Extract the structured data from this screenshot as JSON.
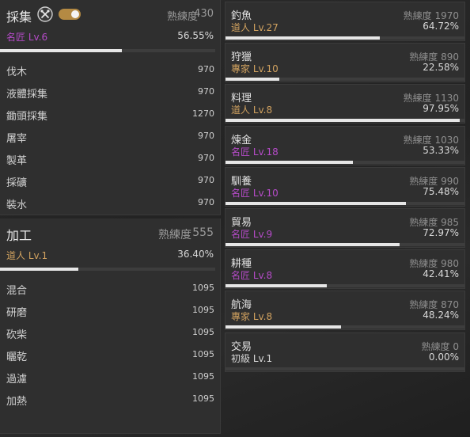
{
  "colors": {
    "level_purple": "#b64bc9",
    "level_gold": "#d0a15f",
    "bar_fill": "#e6e6e6",
    "toggle_accent": "#b48a43"
  },
  "gathering": {
    "title": "採集",
    "icon": "crossed-tools-icon",
    "toggle_state": "on",
    "prof_label": "熟練度",
    "prof_value": "430",
    "level": "名匠 Lv.6",
    "percent": "56.55%",
    "progress": 0.5655,
    "subs": [
      {
        "name": "伐木",
        "value": "970"
      },
      {
        "name": "液體採集",
        "value": "970"
      },
      {
        "name": "鋤頭採集",
        "value": "1270"
      },
      {
        "name": "屠宰",
        "value": "970"
      },
      {
        "name": "製革",
        "value": "970"
      },
      {
        "name": "採礦",
        "value": "970"
      },
      {
        "name": "裝水",
        "value": "970"
      }
    ]
  },
  "processing": {
    "title": "加工",
    "prof_label": "熟練度",
    "prof_value": "555",
    "level": "道人 Lv.1",
    "percent": "36.40%",
    "progress": 0.364,
    "subs": [
      {
        "name": "混合",
        "value": "1095"
      },
      {
        "name": "研磨",
        "value": "1095"
      },
      {
        "name": "砍柴",
        "value": "1095"
      },
      {
        "name": "曬乾",
        "value": "1095"
      },
      {
        "name": "過濾",
        "value": "1095"
      },
      {
        "name": "加熱",
        "value": "1095"
      }
    ]
  },
  "skills": [
    {
      "name": "釣魚",
      "prof_label": "熟練度",
      "prof_value": "1970",
      "level": "道人 Lv.27",
      "level_color": "gold",
      "percent": "64.72%",
      "progress": 0.6472
    },
    {
      "name": "狩獵",
      "prof_label": "熟練度",
      "prof_value": "890",
      "level": "專家 Lv.10",
      "level_color": "gold",
      "percent": "22.58%",
      "progress": 0.2258
    },
    {
      "name": "料理",
      "prof_label": "熟練度",
      "prof_value": "1130",
      "level": "道人 Lv.8",
      "level_color": "gold",
      "percent": "97.95%",
      "progress": 0.9795
    },
    {
      "name": "煉金",
      "prof_label": "熟練度",
      "prof_value": "1030",
      "level": "名匠 Lv.18",
      "level_color": "purple",
      "percent": "53.33%",
      "progress": 0.5333
    },
    {
      "name": "馴養",
      "prof_label": "熟練度",
      "prof_value": "990",
      "level": "名匠 Lv.10",
      "level_color": "purple",
      "percent": "75.48%",
      "progress": 0.7548
    },
    {
      "name": "貿易",
      "prof_label": "熟練度",
      "prof_value": "985",
      "level": "名匠 Lv.9",
      "level_color": "purple",
      "percent": "72.97%",
      "progress": 0.7297
    },
    {
      "name": "耕種",
      "prof_label": "熟練度",
      "prof_value": "980",
      "level": "名匠 Lv.8",
      "level_color": "purple",
      "percent": "42.41%",
      "progress": 0.4241
    },
    {
      "name": "航海",
      "prof_label": "熟練度",
      "prof_value": "870",
      "level": "專家 Lv.8",
      "level_color": "gold",
      "percent": "48.24%",
      "progress": 0.4824
    },
    {
      "name": "交易",
      "prof_label": "熟練度",
      "prof_value": "0",
      "level": "初級 Lv.1",
      "level_color": "white",
      "percent": "0.00%",
      "progress": 0
    }
  ]
}
